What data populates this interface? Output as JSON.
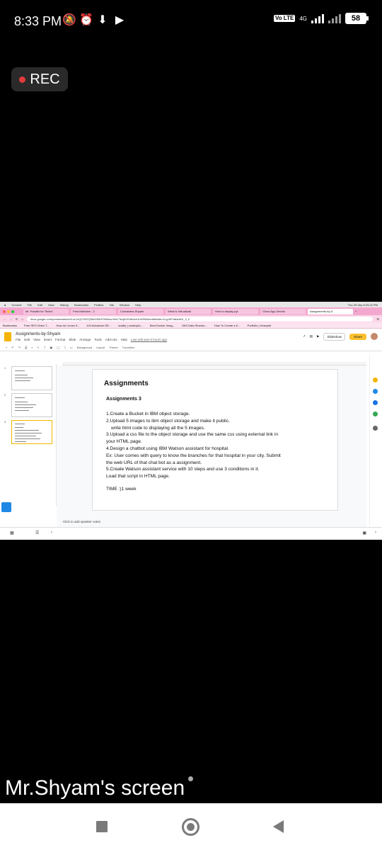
{
  "status_bar": {
    "time": "8:33 PM",
    "network": "4G",
    "lte": "Vo LTE",
    "battery": "58"
  },
  "recording": {
    "label": "REC"
  },
  "browser": {
    "mac_menu": [
      "Chrome",
      "File",
      "Edit",
      "View",
      "History",
      "Bookmarks",
      "Profiles",
      "Tab",
      "Window",
      "Help"
    ],
    "clock": "Thu 29 Sep 8:29:22 PM",
    "tabs": [
      "Mr. Parallel for Techni",
      "Post Attendee - 2",
      "Containers-Shyam",
      "What is Virtualizati",
      "How to display pyt",
      "Cloud App Develo",
      "Assignments-by-S"
    ],
    "url": "docs.google.com/presentation/d/1oc1xQO3SZQ9lm5S8rF0Wbkw.WnCTscj6VKWkAzULW9WA/edit#slide=id.g15f7a6adf1b_3_0",
    "bookmarks": [
      "Bookmarks",
      "Free SEO Video T...",
      "How do I know if...",
      "104 Advanced SE...",
      "scality | costexplo...",
      "Best Docker Imag...",
      "SAS Data Structur...",
      "How To Create a K...",
      "Portfolio | Heavybit"
    ]
  },
  "doc": {
    "title": "Assignments-by-Shyam",
    "menu": [
      "File",
      "Edit",
      "View",
      "Insert",
      "Format",
      "Slide",
      "Arrange",
      "Tools",
      "Add-ons",
      "Help"
    ],
    "last_edit": "Last edit was 9 hours ago",
    "slideshow": "Slideshow",
    "share": "Share",
    "toolbar": [
      "Background",
      "Layout",
      "Theme",
      "Transition"
    ]
  },
  "slide": {
    "title": "Assignments",
    "subtitle": "Assignments 3",
    "lines": [
      "1.Create a Bucket in IBM object storage.",
      "2.Upload 5 images  to ibm object storage and make it public.",
      "write html code to displaying all the 5 images.",
      "3.Upload a css file to the object storage and use the same css using external link in",
      "your HTML page.",
      "4.Design a chatbot using IBM Watson assistant for hospital.",
      "Ex: User comes with query to know the branches for that hospital in your city. Submit",
      "the web URL of that chat bot as a assignment.",
      "5.Create Watson assistant service with 10 steps and use 3 conditions in it.",
      "Load that script in HTML page."
    ],
    "time": "TIME :)1 week"
  },
  "filmstrip": {
    "numbers": [
      "1",
      "2",
      "3"
    ]
  },
  "speaker_notes": "Click to add speaker notes",
  "caption": "Mr.Shyam's screen"
}
